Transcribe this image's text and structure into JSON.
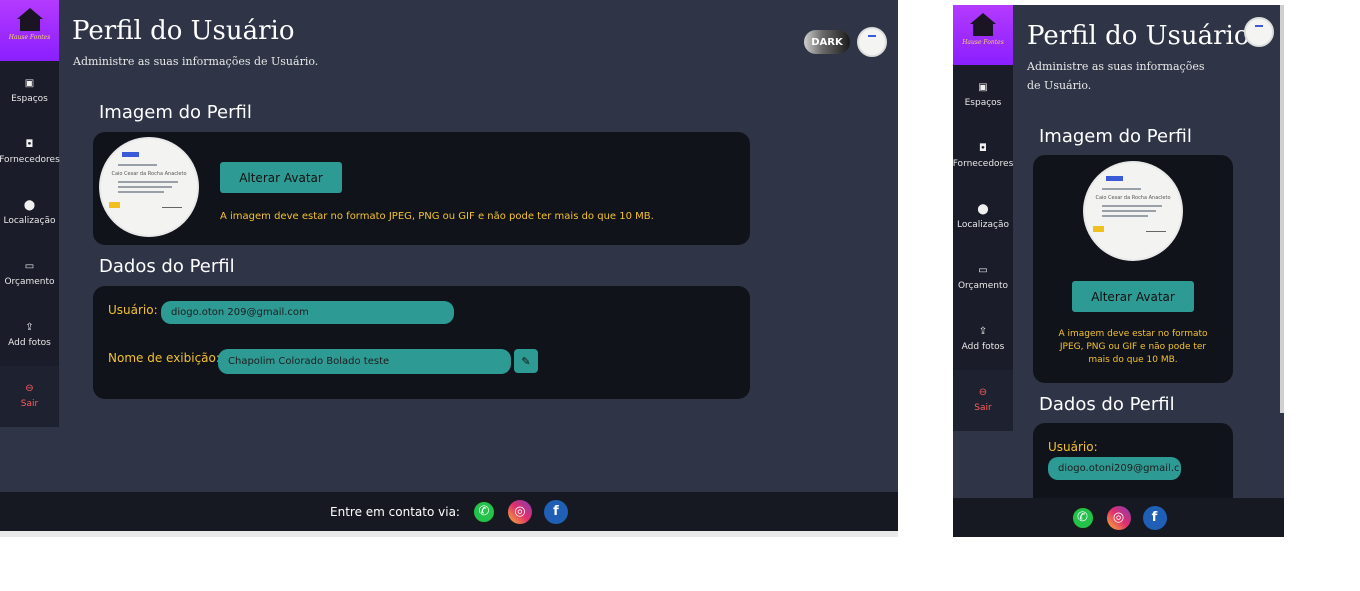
{
  "app": {
    "brand": "Hause Fontes"
  },
  "header": {
    "title": "Perfil do Usuário",
    "subtitle": "Administre as suas informações de Usuário.",
    "theme_toggle": "DARK"
  },
  "sidebar": {
    "items": [
      {
        "label": "Espaços",
        "icon": "image-icon",
        "glyph": "▣"
      },
      {
        "label": "Fornecedores",
        "icon": "briefcase-icon",
        "glyph": "◘"
      },
      {
        "label": "Localização",
        "icon": "map-pin-icon",
        "glyph": "⬤"
      },
      {
        "label": "Orçamento",
        "icon": "credit-card-icon",
        "glyph": "▭"
      },
      {
        "label": "Add fotos",
        "icon": "upload-icon",
        "glyph": "⇪"
      },
      {
        "label": "Sair",
        "icon": "logout-icon",
        "glyph": "⊖"
      }
    ]
  },
  "profile_image": {
    "section_title": "Imagem do Perfil",
    "button": "Alterar Avatar",
    "note": "A imagem deve estar no formato JPEG, PNG ou GIF e não pode ter mais do que 10 MB.",
    "avatar_text": "Caio Cesar da Rocha Anacleto"
  },
  "profile_data": {
    "section_title": "Dados do Perfil",
    "user_label": "Usuário:",
    "user_value": "diogo.oton 209@gmail.com",
    "user_value_mobile": "diogo.otoni209@gmail.c",
    "display_label": "Nome de exibição:",
    "display_value": "Chapolim Colorado Bolado teste"
  },
  "footer": {
    "contact_label": "Entre em contato via:"
  },
  "colors": {
    "background": "#2f3547",
    "sidebar": "#1a1d29",
    "card": "#11131a",
    "accent": "#2e9a94",
    "warning": "#f2c230",
    "logout": "#ff5c5c",
    "brand": "#8a1fff"
  }
}
